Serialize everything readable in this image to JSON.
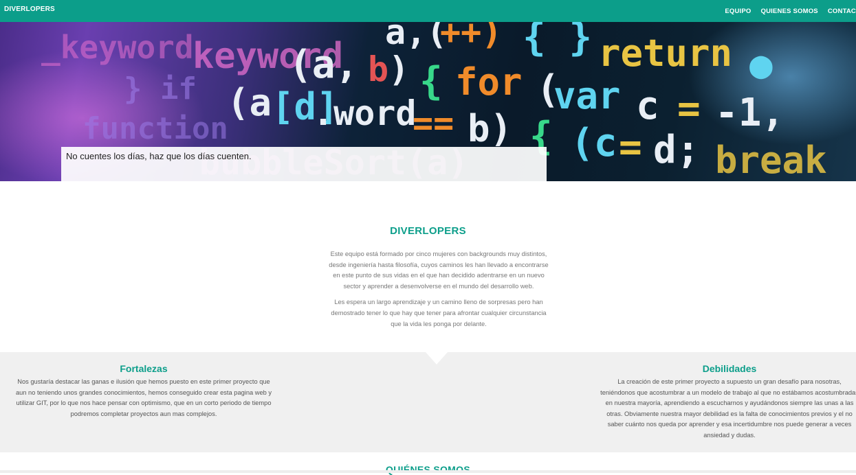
{
  "navbar": {
    "brand": "DIVERLOPERS",
    "links": [
      "EQUIPO",
      "QUIENES SOMOS",
      "CONTAC"
    ]
  },
  "hero": {
    "quote": "No cuentes los días, haz que los días cuenten."
  },
  "about": {
    "title": "DIVERLOPERS",
    "paragraph1": "Este equipo está formado por cinco mujeres con backgrounds muy distintos, desde ingeniería hasta filosofía, cuyos caminos les han llevado a encontrarse en este punto de sus vidas en el que han decidido adentrarse en un nuevo sector y aprender a desenvolverse en el mundo del desarrollo web.",
    "paragraph2": "Les espera un largo aprendizaje y un camino lleno de sorpresas pero han demostrado tener lo que hay que tener para afrontar cualquier circunstancia que la vida les ponga por delante."
  },
  "strengths": {
    "title": "Fortalezas",
    "text": "Nos gustaría destacar las ganas e ilusión que hemos puesto en este primer proyecto que aun no teniendo unos grandes conocimientos, hemos conseguido crear esta pagina web y utilizar GIT, por lo que nos hace pensar con optimismo, que en un corto periodo de tiempo podremos completar proyectos aun mas complejos."
  },
  "weaknesses": {
    "title": "Debilidades",
    "text": "La creación de este primer proyecto a supuesto un gran desafío para nosotras, teniéndonos que acostumbrar a un modelo de trabajo al que no estábamos acostumbradas en nuestra mayoría, aprendiendo a escucharnos y ayudándonos siempre las unas a las otras. Obviamente nuestra mayor debilidad es la falta de conocimientos previos y el no saber cuánto nos queda por aprender y esa incertidumbre nos puede generar a veces ansiedad y dudas."
  },
  "quienes": {
    "title": "QUIÉNES SOMOS"
  },
  "colors": {
    "accent": "#0c9e8a",
    "band_background": "#f0f0f0"
  }
}
